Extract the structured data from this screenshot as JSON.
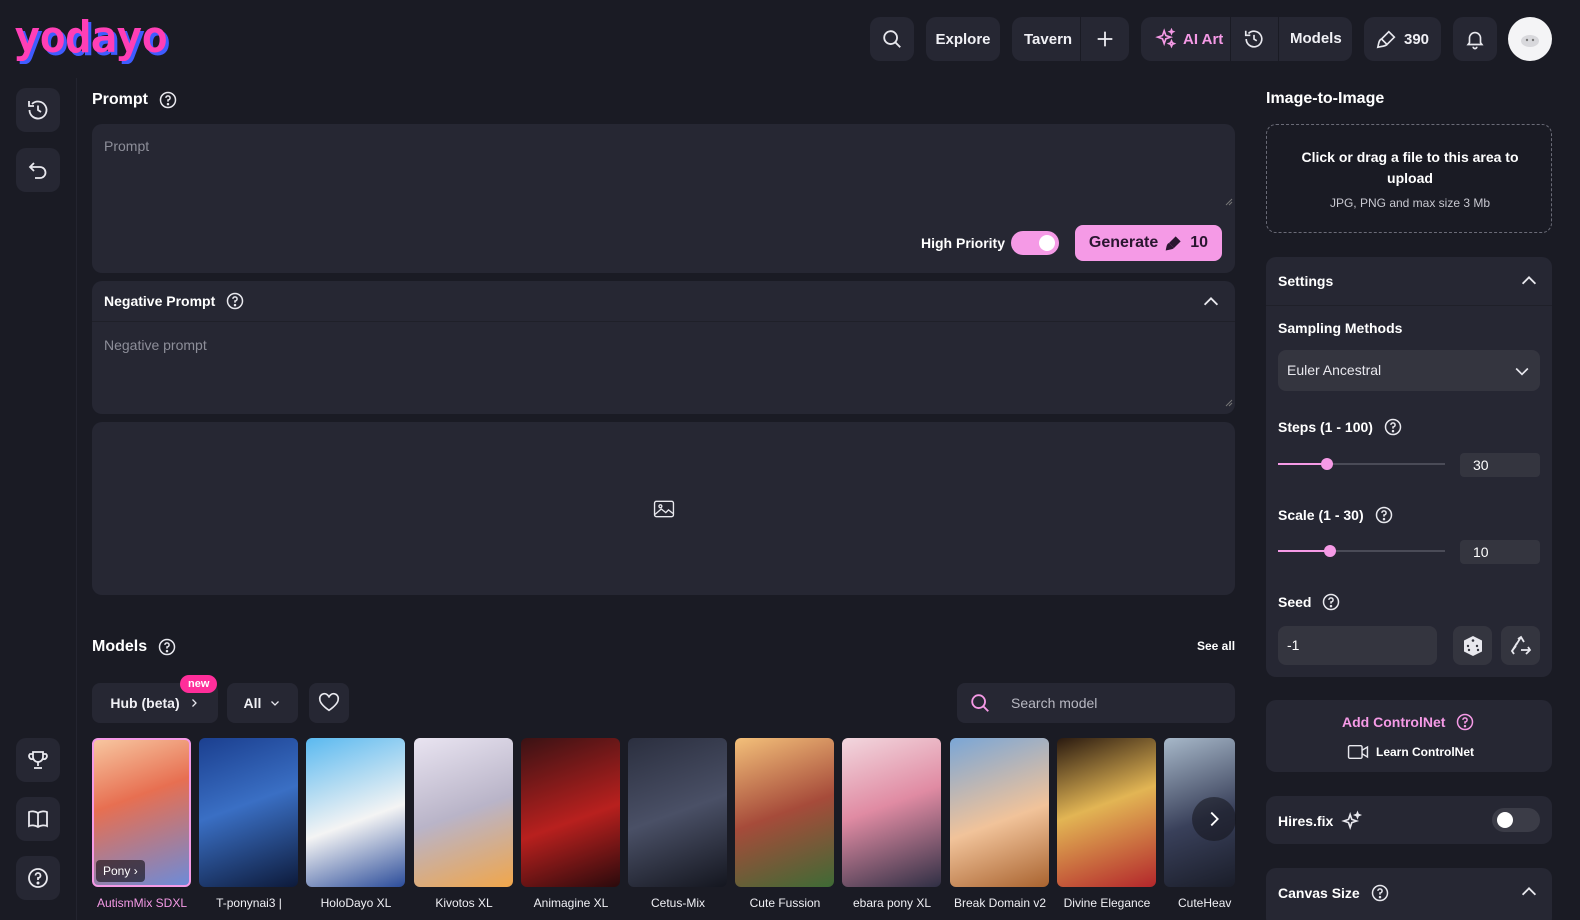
{
  "brand": {
    "logo": "yodayo",
    "accent": "#f59ae6",
    "pink": "#ff2e9a"
  },
  "nav": {
    "explore": "Explore",
    "tavern": "Tavern",
    "ai_art": "AI Art",
    "models": "Models",
    "credits": "390"
  },
  "prompt": {
    "title": "Prompt",
    "placeholder": "Prompt",
    "high_priority_label": "High Priority",
    "high_priority_on": true,
    "generate_label": "Generate",
    "generate_cost": "10"
  },
  "negative_prompt": {
    "title": "Negative Prompt",
    "placeholder": "Negative prompt"
  },
  "models": {
    "title": "Models",
    "see_all": "See all",
    "hub_label": "Hub (beta)",
    "new_badge": "new",
    "filter_label": "All",
    "search_placeholder": "Search model",
    "selected_tag": "Pony",
    "items": [
      {
        "name": "AutismMix SDXL",
        "selected": true
      },
      {
        "name": "T-ponynai3 |"
      },
      {
        "name": "HoloDayo XL"
      },
      {
        "name": "Kivotos XL"
      },
      {
        "name": "Animagine XL"
      },
      {
        "name": "Cetus-Mix"
      },
      {
        "name": "Cute Fussion"
      },
      {
        "name": "ebara pony XL"
      },
      {
        "name": "Break Domain v2"
      },
      {
        "name": "Divine Elegance"
      },
      {
        "name": "CuteHeav"
      }
    ]
  },
  "img2img": {
    "title": "Image-to-Image",
    "upload_main": "Click or drag a file to this area to upload",
    "upload_sub": "JPG, PNG and max size 3 Mb"
  },
  "settings": {
    "title": "Settings",
    "sampling_label": "Sampling Methods",
    "sampling_value": "Euler Ancestral",
    "steps_label": "Steps (1 - 100)",
    "steps_value": "30",
    "scale_label": "Scale (1 - 30)",
    "scale_value": "10",
    "seed_label": "Seed",
    "seed_value": "-1"
  },
  "controlnet": {
    "add_label": "Add ControlNet",
    "learn_label": "Learn ControlNet"
  },
  "hires": {
    "label": "Hires.fix",
    "enabled": false
  },
  "canvas": {
    "label": "Canvas Size"
  }
}
